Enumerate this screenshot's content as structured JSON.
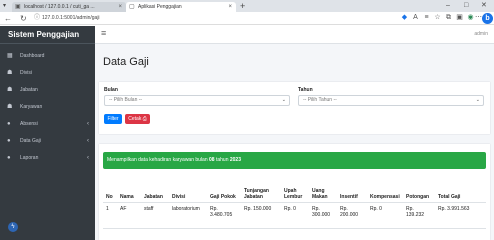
{
  "browser": {
    "tabs": [
      {
        "label": "localhost / 127.0.0.1 / cuti_ga ...",
        "icon": "folder-icon"
      },
      {
        "label": "Aplikasi Penggajian",
        "icon": "page-icon"
      }
    ],
    "url": "127.0.0.1:5001/admin/gaji"
  },
  "sidebar": {
    "brand": "Sistem Penggajian",
    "items": [
      {
        "label": "Dashboard",
        "icon": "dashboard-icon",
        "has_children": false
      },
      {
        "label": "Divisi",
        "icon": "users-icon",
        "has_children": false
      },
      {
        "label": "Jabatan",
        "icon": "users-icon",
        "has_children": false
      },
      {
        "label": "Karyawan",
        "icon": "users-icon",
        "has_children": false
      },
      {
        "label": "Absensi",
        "icon": "circle-icon",
        "has_children": true
      },
      {
        "label": "Data Gaji",
        "icon": "circle-icon",
        "has_children": true
      },
      {
        "label": "Laporan",
        "icon": "circle-icon",
        "has_children": true
      }
    ]
  },
  "topnav": {
    "user": "admin"
  },
  "page": {
    "title": "Data Gaji"
  },
  "filter": {
    "bulan_label": "Bulan",
    "bulan_value": "-- Pilih Bulan --",
    "tahun_label": "Tahun",
    "tahun_value": "-- Pilih Tahun --",
    "filter_button": "Filter",
    "print_button": "Cetak"
  },
  "alert": {
    "prefix": "Menampilkan data kehadiran karyawan bulan ",
    "month": "08",
    "middle": " tahun ",
    "year": "2023"
  },
  "table": {
    "headers": [
      "No",
      "Nama",
      "Jabatan",
      "Divisi",
      "Gaji Pokok",
      "Tunjangan Jabatan",
      "Upah Lembur",
      "Uang Makan",
      "Insentif",
      "Kompensasi",
      "Potongan",
      "Total Gaji"
    ],
    "rows": [
      [
        "1",
        "AF",
        "staff",
        "laboratorium",
        "Rp. 3.480.705",
        "Rp. 150.000",
        "Rp. 0",
        "Rp. 300.000",
        "Rp. 200.000",
        "Rp. 0",
        "Rp. 139.232",
        "Rp. 3.991.563"
      ]
    ]
  },
  "colors": {
    "sidebar_bg": "#343a40",
    "alert_bg": "#28a745",
    "filter_btn": "#007bff",
    "print_btn": "#dc3545"
  }
}
